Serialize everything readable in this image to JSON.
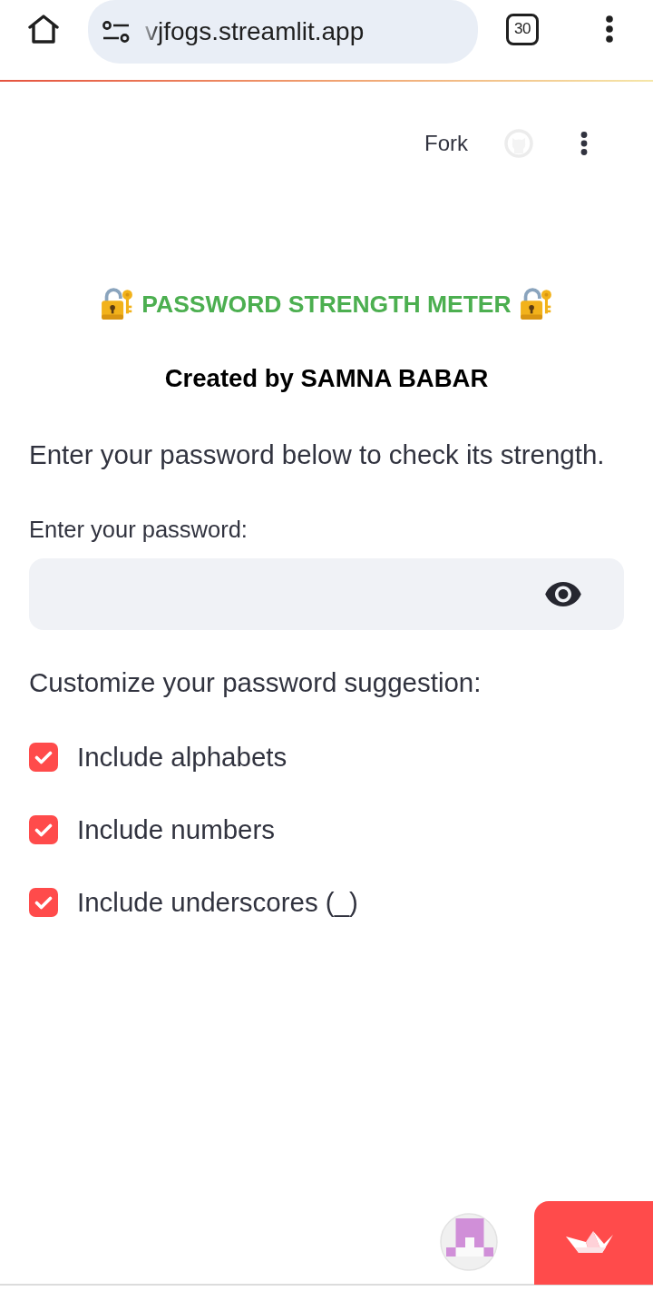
{
  "browser": {
    "url": "vjfogs.streamlit.app",
    "tab_count": "30"
  },
  "app_header": {
    "fork_label": "Fork"
  },
  "title": "PASSWORD STRENGTH METER",
  "subtitle": "Created by SAMNA BABAR",
  "intro": "Enter your password below to check its strength.",
  "password_field": {
    "label": "Enter your password:"
  },
  "suggestions": {
    "heading": "Customize your password suggestion:",
    "options": [
      {
        "label": "Include alphabets",
        "checked": true
      },
      {
        "label": "Include numbers",
        "checked": true
      },
      {
        "label": "Include underscores (_)",
        "checked": true
      }
    ]
  }
}
